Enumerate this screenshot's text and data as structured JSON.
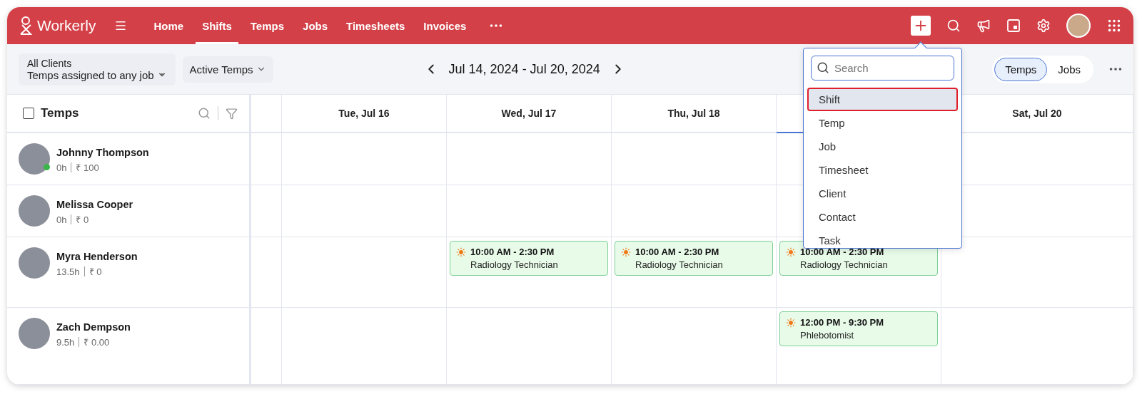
{
  "app": {
    "name": "Workerly"
  },
  "nav": [
    {
      "label": "Home",
      "selected": false
    },
    {
      "label": "Shifts",
      "selected": true
    },
    {
      "label": "Temps",
      "selected": false
    },
    {
      "label": "Jobs",
      "selected": false
    },
    {
      "label": "Timesheets",
      "selected": false
    },
    {
      "label": "Invoices",
      "selected": false
    }
  ],
  "toolbar": {
    "client_filter": {
      "label": "All Clients",
      "value": "Temps assigned to any job"
    },
    "status_filter": "Active Temps",
    "date_range": "Jul 14, 2024 - Jul 20, 2024",
    "view_toggle": [
      {
        "label": "Temps",
        "selected": true
      },
      {
        "label": "Jobs",
        "selected": false
      }
    ]
  },
  "grid": {
    "title": "Temps",
    "select_all_checked": false,
    "columns": [
      {
        "kind": "partial",
        "today": false
      },
      {
        "kind": "day",
        "label": "Tue, Jul 16",
        "today": false
      },
      {
        "kind": "day",
        "label": "Wed, Jul 17",
        "today": false
      },
      {
        "kind": "day",
        "label": "Thu, Jul 18",
        "today": false
      },
      {
        "kind": "covered",
        "today": true
      },
      {
        "kind": "day",
        "label": "Sat, Jul 20",
        "today": false
      }
    ],
    "rows": [
      {
        "name": "Johnny Thompson",
        "hours": "0h",
        "rate": "₹ 100",
        "online": true,
        "cells": [
          {
            "kind": "empty"
          },
          {
            "kind": "empty"
          },
          {
            "kind": "empty"
          },
          {
            "kind": "empty"
          },
          {
            "kind": "empty"
          },
          {
            "kind": "empty"
          }
        ]
      },
      {
        "name": "Melissa Cooper",
        "hours": "0h",
        "rate": "₹ 0",
        "online": false,
        "cells": [
          {
            "kind": "empty"
          },
          {
            "kind": "empty"
          },
          {
            "kind": "empty"
          },
          {
            "kind": "empty"
          },
          {
            "kind": "empty"
          },
          {
            "kind": "empty"
          }
        ]
      },
      {
        "name": "Myra Henderson",
        "hours": "13.5h",
        "rate": "₹ 0",
        "online": false,
        "cells": [
          {
            "kind": "empty"
          },
          {
            "kind": "empty"
          },
          {
            "kind": "shift",
            "time": "10:00 AM - 2:30 PM",
            "role": "Radiology Technician"
          },
          {
            "kind": "shift",
            "time": "10:00 AM - 2:30 PM",
            "role": "Radiology Technician"
          },
          {
            "kind": "shift",
            "time": "10:00 AM - 2:30 PM",
            "role": "Radiology Technician"
          },
          {
            "kind": "empty"
          }
        ]
      },
      {
        "name": "Zach Dempson",
        "hours": "9.5h",
        "rate": "₹ 0.00",
        "online": false,
        "cells": [
          {
            "kind": "empty"
          },
          {
            "kind": "empty"
          },
          {
            "kind": "empty"
          },
          {
            "kind": "empty"
          },
          {
            "kind": "shift",
            "time": "12:00 PM - 9:30 PM",
            "role": "Phlebotomist"
          },
          {
            "kind": "empty"
          }
        ]
      }
    ]
  },
  "create_menu": {
    "search": {
      "placeholder": "Search"
    },
    "items": [
      {
        "label": "Shift",
        "selected": true
      },
      {
        "label": "Temp",
        "selected": false
      },
      {
        "label": "Job",
        "selected": false
      },
      {
        "label": "Timesheet",
        "selected": false
      },
      {
        "label": "Client",
        "selected": false
      },
      {
        "label": "Contact",
        "selected": false
      },
      {
        "label": "Task",
        "selected": false
      }
    ]
  }
}
